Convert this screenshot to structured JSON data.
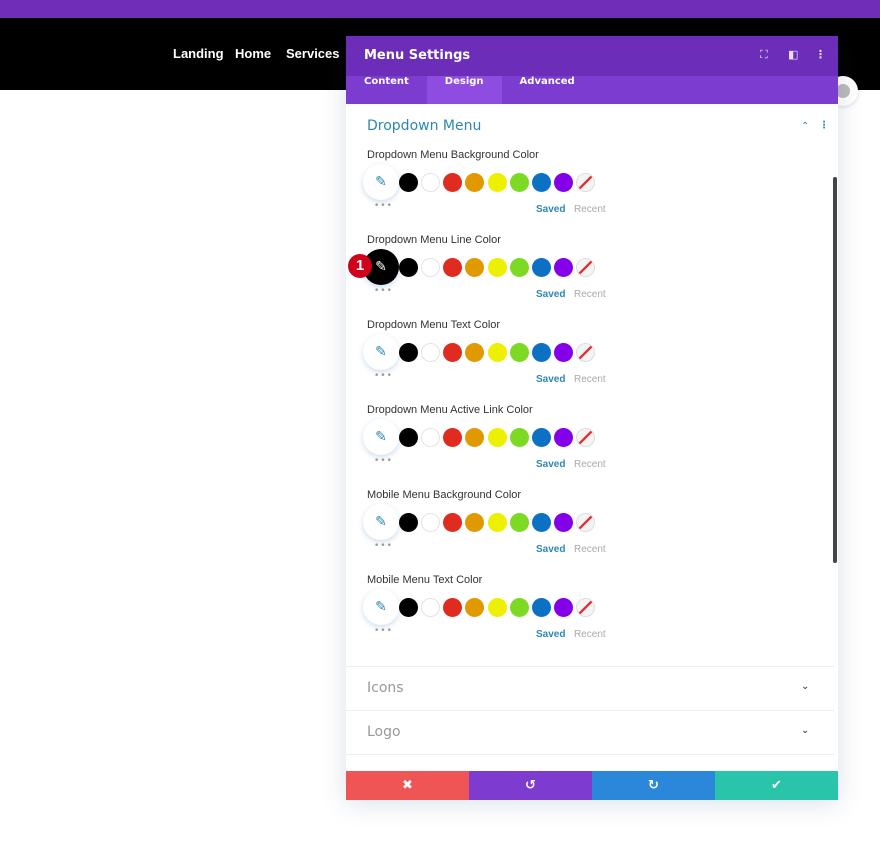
{
  "site": {
    "nav": [
      "Landing",
      "Home",
      "Services"
    ]
  },
  "panel": {
    "title": "Menu Settings",
    "tabs": [
      {
        "label": "Content"
      },
      {
        "label": "Design"
      },
      {
        "label": "Advanced"
      }
    ],
    "active_tab": "Design",
    "section": {
      "title": "Dropdown Menu",
      "expanded": true
    },
    "swatches": [
      "#000000",
      "#ffffff",
      "#e02b20",
      "#e09900",
      "#edf000",
      "#7cda24",
      "#0c71c3",
      "#8300e9",
      "none"
    ],
    "saved_label": "Saved",
    "recent_label": "Recent",
    "rows": [
      {
        "label": "Dropdown Menu Background Color"
      },
      {
        "label": "Dropdown Menu Line Color",
        "value": "#000000",
        "badge": "1"
      },
      {
        "label": "Dropdown Menu Text Color"
      },
      {
        "label": "Dropdown Menu Active Link Color"
      },
      {
        "label": "Mobile Menu Background Color"
      },
      {
        "label": "Mobile Menu Text Color"
      }
    ],
    "collapsed_sections": [
      "Icons",
      "Logo"
    ],
    "footer": {
      "colors": {
        "cancel": "#ef5555",
        "undo": "#7e3bd0",
        "redo": "#2b87da",
        "save": "#29c4a9"
      }
    }
  }
}
